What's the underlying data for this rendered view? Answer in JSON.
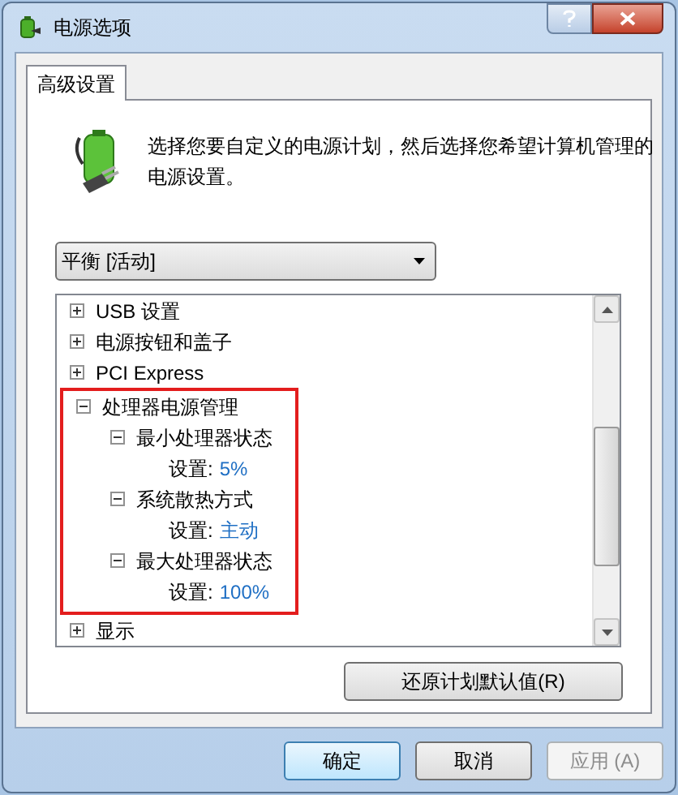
{
  "window": {
    "title": "电源选项"
  },
  "tabs": [
    {
      "label": "高级设置",
      "selected": true
    }
  ],
  "description": "选择您要自定义的电源计划，然后选择您希望计算机管理的电源设置。",
  "plan_dropdown": {
    "value": "平衡 [活动]"
  },
  "tree": [
    {
      "label": "USB 设置",
      "expanded": false
    },
    {
      "label": "电源按钮和盖子",
      "expanded": false
    },
    {
      "label": "PCI Express",
      "expanded": false
    },
    {
      "label": "处理器电源管理",
      "expanded": true,
      "highlighted": true,
      "children": [
        {
          "label": "最小处理器状态",
          "expanded": true,
          "setting": {
            "label": "设置:",
            "value": "5%"
          }
        },
        {
          "label": "系统散热方式",
          "expanded": true,
          "setting": {
            "label": "设置:",
            "value": "主动"
          }
        },
        {
          "label": "最大处理器状态",
          "expanded": true,
          "setting": {
            "label": "设置:",
            "value": "100%"
          }
        }
      ]
    },
    {
      "label": "显示",
      "expanded": false
    }
  ],
  "restore_button": "还原计划默认值(R)",
  "buttons": [
    {
      "label": "确定",
      "kind": "default",
      "disabled": false
    },
    {
      "label": "取消",
      "kind": "normal",
      "disabled": false
    },
    {
      "label": "应用 (A)",
      "kind": "normal",
      "disabled": true
    }
  ]
}
